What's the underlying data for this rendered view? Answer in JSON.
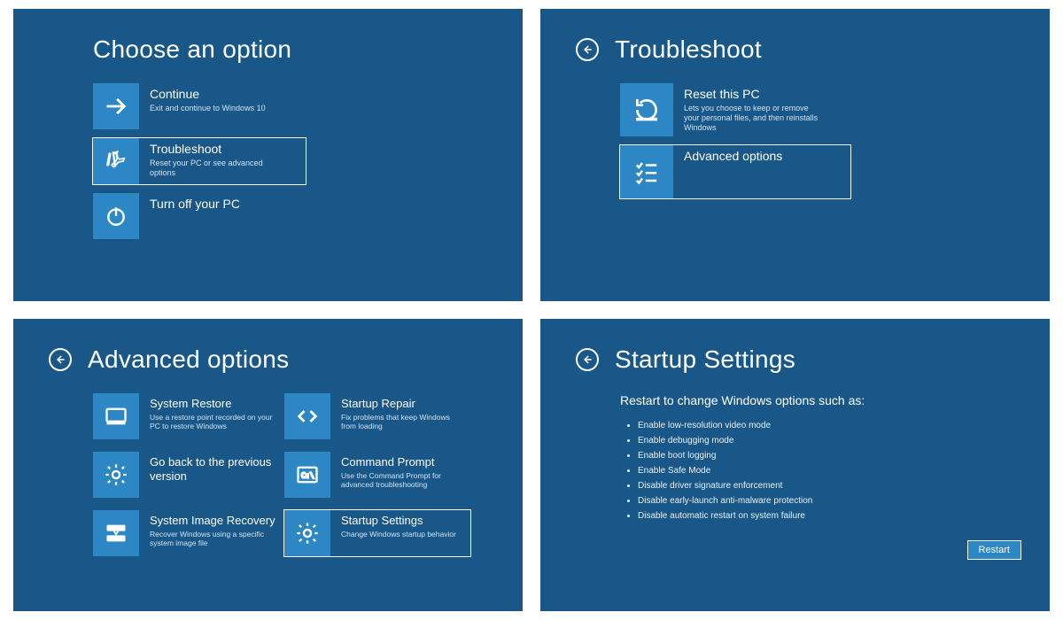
{
  "panel1": {
    "title": "Choose an option",
    "tiles": [
      {
        "title": "Continue",
        "sub": "Exit and continue to Windows 10"
      },
      {
        "title": "Troubleshoot",
        "sub": "Reset your PC or see advanced options"
      },
      {
        "title": "Turn off your PC",
        "sub": ""
      }
    ]
  },
  "panel2": {
    "title": "Troubleshoot",
    "tiles": [
      {
        "title": "Reset this PC",
        "sub": "Lets you choose to keep or remove your personal files, and then reinstalls Windows"
      },
      {
        "title": "Advanced options",
        "sub": ""
      }
    ]
  },
  "panel3": {
    "title": "Advanced options",
    "tiles": [
      {
        "title": "System Restore",
        "sub": "Use a restore point recorded on your PC to restore Windows"
      },
      {
        "title": "Startup Repair",
        "sub": "Fix problems that keep Windows from loading"
      },
      {
        "title": "Go back to the previous version",
        "sub": ""
      },
      {
        "title": "Command Prompt",
        "sub": "Use the Command Prompt for advanced troubleshooting"
      },
      {
        "title": "System Image Recovery",
        "sub": "Recover Windows using a specific system image file"
      },
      {
        "title": "Startup Settings",
        "sub": "Change Windows startup behavior"
      }
    ]
  },
  "panel4": {
    "title": "Startup Settings",
    "subhead": "Restart to change Windows options such as:",
    "bullets": [
      "Enable low-resolution video mode",
      "Enable debugging mode",
      "Enable boot logging",
      "Enable Safe Mode",
      "Disable driver signature enforcement",
      "Disable early-launch anti-malware protection",
      "Disable automatic restart on system failure"
    ],
    "restart": "Restart"
  }
}
